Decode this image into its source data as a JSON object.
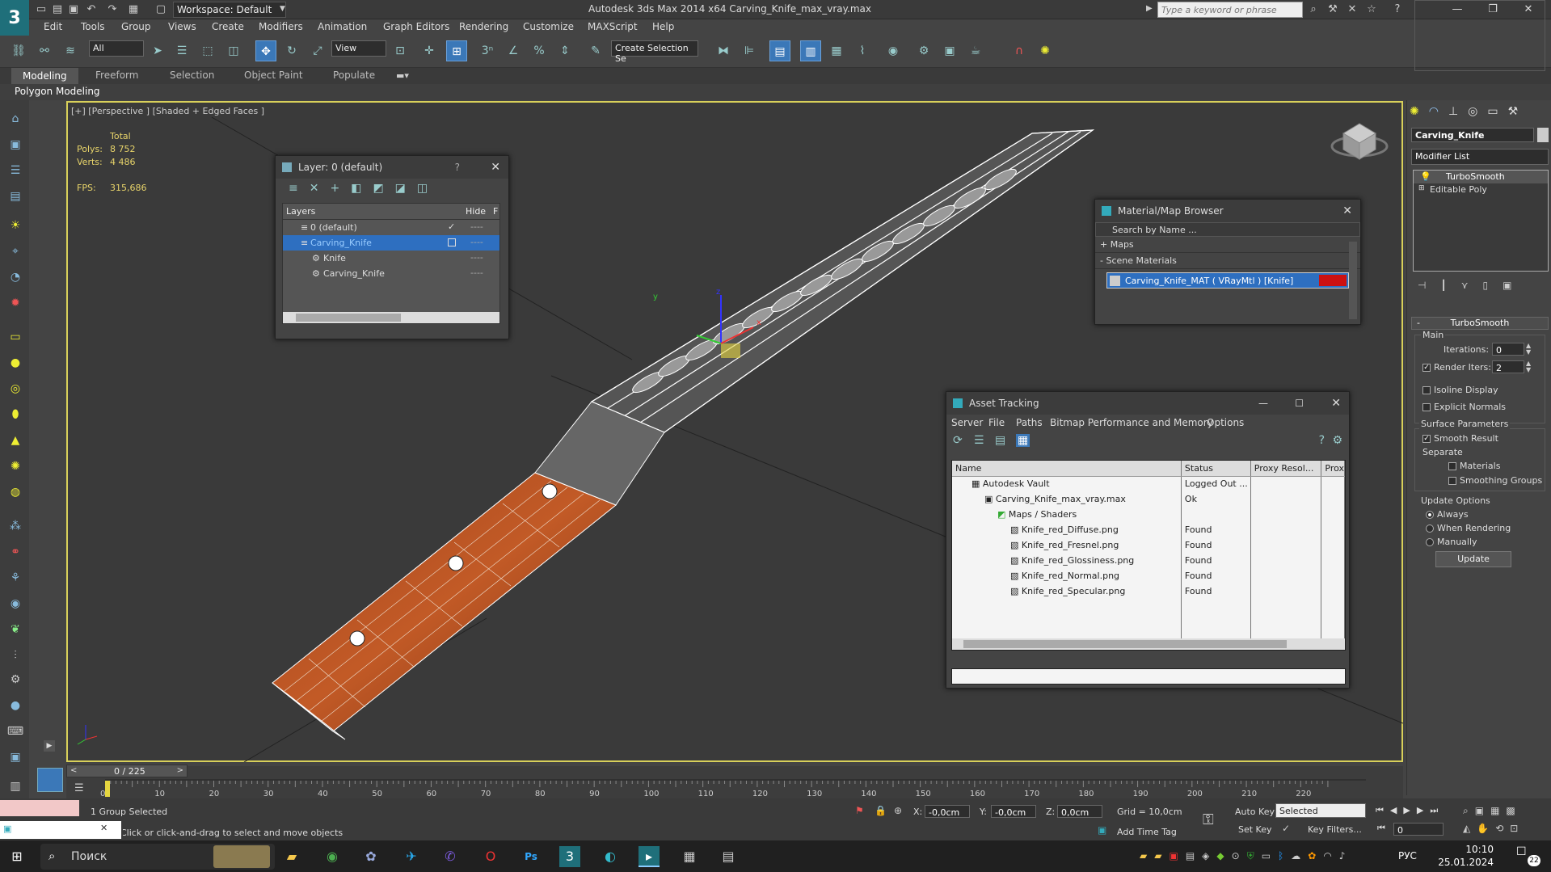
{
  "window": {
    "title": "Autodesk 3ds Max  2014 x64    Carving_Knife_max_vray.max",
    "workspace": "Workspace: Default",
    "search_placeholder": "Type a keyword or phrase"
  },
  "menu": [
    "Edit",
    "Tools",
    "Group",
    "Views",
    "Create",
    "Modifiers",
    "Animation",
    "Graph Editors",
    "Rendering",
    "Customize",
    "MAXScript",
    "Help"
  ],
  "toolbar": {
    "filter": "All",
    "ref_coord": "View",
    "selection_set": "Create Selection Se"
  },
  "ribbon": {
    "tabs": [
      "Modeling",
      "Freeform",
      "Selection",
      "Object Paint",
      "Populate"
    ],
    "sub_label": "Polygon Modeling"
  },
  "viewport": {
    "label": "[+] [Perspective ] [Shaded + Edged Faces ]",
    "stats": {
      "total_label": "Total",
      "polys_label": "Polys:",
      "polys": "8 752",
      "verts_label": "Verts:",
      "verts": "4 486",
      "fps_label": "FPS:",
      "fps": "315,686"
    },
    "axis_x": "x",
    "axis_y": "y",
    "axis_z": "z"
  },
  "layer_dialog": {
    "title": "Layer: 0 (default)",
    "help": "?",
    "col_layers": "Layers",
    "col_hide": "Hide",
    "col_f": "F",
    "rows": [
      {
        "name": "0 (default)",
        "check": "✓",
        "dots": "----"
      },
      {
        "name": "Carving_Knife",
        "check": "",
        "dots": "----"
      },
      {
        "name": "Knife",
        "check": "",
        "dots": "----"
      },
      {
        "name": "Carving_Knife",
        "check": "",
        "dots": "----"
      }
    ]
  },
  "material_browser": {
    "title": "Material/Map Browser",
    "search_placeholder": "Search by Name ...",
    "maps": "+ Maps",
    "scene_materials": "- Scene Materials",
    "material": "Carving_Knife_MAT  ( VRayMtl )  [Knife]",
    "swatch_color": "#cc1111"
  },
  "asset_tracking": {
    "title": "Asset Tracking",
    "menus": [
      "Server",
      "File",
      "Paths",
      "Bitmap Performance and Memory",
      "Options"
    ],
    "columns": [
      "Name",
      "Status",
      "Proxy Resol...",
      "Prox"
    ],
    "rows": [
      {
        "name": "Autodesk Vault",
        "status": "Logged Out ..."
      },
      {
        "name": "Carving_Knife_max_vray.max",
        "status": "Ok"
      },
      {
        "name": "Maps / Shaders",
        "status": ""
      },
      {
        "name": "Knife_red_Diffuse.png",
        "status": "Found"
      },
      {
        "name": "Knife_red_Fresnel.png",
        "status": "Found"
      },
      {
        "name": "Knife_red_Glossiness.png",
        "status": "Found"
      },
      {
        "name": "Knife_red_Normal.png",
        "status": "Found"
      },
      {
        "name": "Knife_red_Specular.png",
        "status": "Found"
      }
    ]
  },
  "command_panel": {
    "object_name": "Carving_Knife",
    "modifier_list": "Modifier List",
    "stack": [
      "TurboSmooth",
      "Editable Poly"
    ],
    "rollout": "TurboSmooth",
    "main": "Main",
    "iterations_label": "Iterations:",
    "iterations": "0",
    "render_iters_label": "Render Iters:",
    "render_iters": "2",
    "isoline": "Isoline Display",
    "explicit": "Explicit Normals",
    "surface": "Surface Parameters",
    "smooth_result": "Smooth Result",
    "separate": "Separate",
    "materials": "Materials",
    "smoothing_groups": "Smoothing Groups",
    "update_options": "Update Options",
    "always": "Always",
    "when_rendering": "When Rendering",
    "manually": "Manually",
    "update_btn": "Update"
  },
  "timeline": {
    "frame": "0 / 225",
    "ticks": [
      "0",
      "10",
      "20",
      "30",
      "40",
      "50",
      "60",
      "70",
      "80",
      "90",
      "100",
      "110",
      "120",
      "130",
      "140",
      "150",
      "160",
      "170",
      "180",
      "190",
      "200",
      "210",
      "220"
    ]
  },
  "status": {
    "selected": "1 Group Selected",
    "prompt": "Click or click-and-drag to select and move objects",
    "x_label": "X:",
    "x": "-0,0cm",
    "y_label": "Y:",
    "y": "-0,0cm",
    "z_label": "Z:",
    "z": "0,0cm",
    "grid": "Grid = 10,0cm",
    "add_time_tag": "Add Time Tag",
    "auto_key": "Auto Key",
    "set_key": "Set Key",
    "key_mode": "Selected",
    "key_filters": "Key Filters...",
    "frame_field": "0"
  },
  "taskbar": {
    "search": "Поиск",
    "lang": "РУС",
    "time": "10:10",
    "date": "25.01.2024",
    "notif": "22"
  }
}
